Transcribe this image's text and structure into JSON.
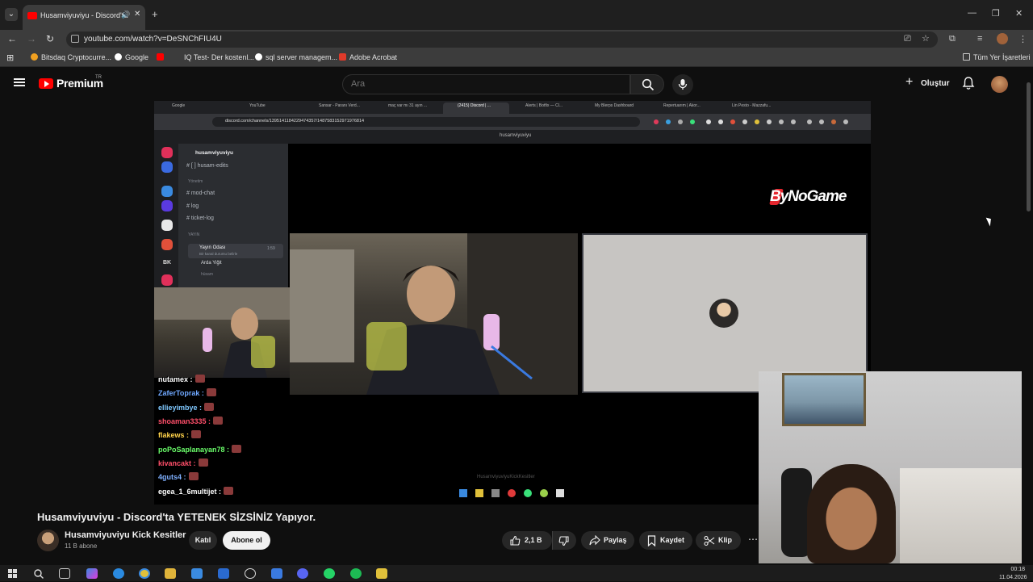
{
  "browser": {
    "tab_title": "Husamviyuviyu - Discord'ta",
    "url": "youtube.com/watch?v=DeSNChFIU4U",
    "bookmarks": [
      "Bitsdaq Cryptocurre...",
      "Google",
      "IQ Test- Der kostenl...",
      "sql server managem...",
      "Adobe Acrobat"
    ],
    "all_bookmarks": "Tüm Yer İşaretleri"
  },
  "youtube": {
    "logo_text": "Premium",
    "region": "TR",
    "search_placeholder": "Ara",
    "create_label": "Oluştur"
  },
  "stream": {
    "inner_tabs": [
      "Google",
      "YouTube",
      "Sansar - Paranı Verd...",
      "maç var mı 31 ayın ...",
      "(2415) Discord | ...",
      "Alerts | Botfix — Cl...",
      "My Blerps Dashboard",
      "Repertuarım | Akor...",
      "Lin Pesto - Mazzafu..."
    ],
    "inner_url": "discord.com/channels/1395141184229474357/1487583152971976814",
    "discord_title": "husamviyuviyu",
    "server_name": "husamviyuviyu",
    "channels": {
      "edits": "[ ] husam-edits",
      "category_admin": "Yönetim",
      "mod_chat": "mod-chat",
      "log": "log",
      "ticket_log": "ticket-log",
      "category_stream": "YAYIN",
      "voice_room": "Yayın Odası",
      "voice_timer": "1:59",
      "voice_sub": "Bir kanal durumu belirle",
      "member_1": "Arda Yiğit",
      "member_2": "hüsam"
    },
    "server_bk": "BK",
    "brand": "ByNoGame",
    "watermark": "HusamviyuviyuKickKesitler",
    "chat": [
      {
        "user": "nutamex :",
        "color": "#ffffff"
      },
      {
        "user": "ZaferToprak :",
        "color": "#6fa8ff"
      },
      {
        "user": "ellieyimbye :",
        "color": "#7fc8ff"
      },
      {
        "user": "shoaman3335 :",
        "color": "#ff4f6a"
      },
      {
        "user": "flakews :",
        "color": "#ffd24a"
      },
      {
        "user": "poPoSaplanayan78 :",
        "color": "#6bff6b"
      },
      {
        "user": "kivancakt :",
        "color": "#ff4f6a"
      },
      {
        "user": "4guts4 :",
        "color": "#7fb0ff"
      },
      {
        "user": "egea_1_6multijet :",
        "color": "#ffffff"
      }
    ]
  },
  "video": {
    "title": "Husamviyuviyu - Discord'ta YETENEK SİZSİNİZ Yapıyor.",
    "channel": "Husamviyuviyu Kick Kesitler",
    "subscribers": "11 B abone",
    "join": "Katıl",
    "subscribe": "Abone ol",
    "likes": "2,1 B",
    "share": "Paylaş",
    "save": "Kaydet",
    "clip": "Klip"
  },
  "taskbar": {
    "time": "00:18",
    "date": "11.04.2026"
  }
}
